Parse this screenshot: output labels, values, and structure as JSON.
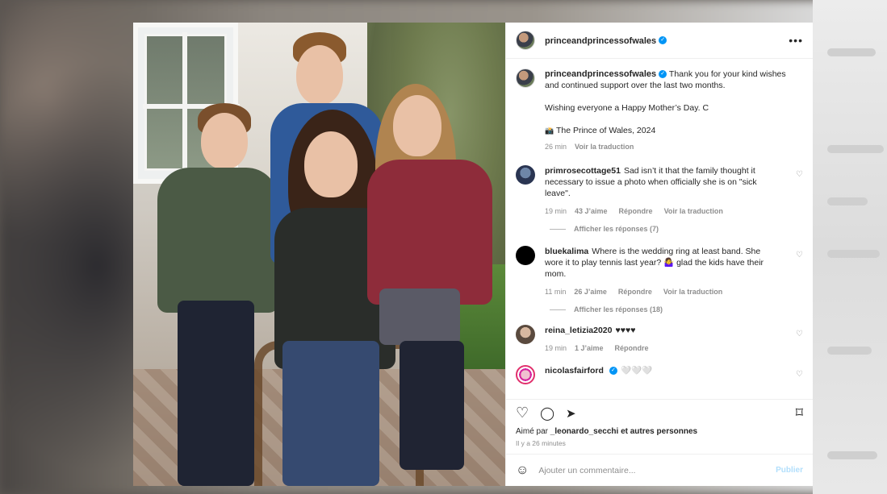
{
  "account": {
    "username": "princeandprincessofwales",
    "verified_mark": "✓"
  },
  "header": {
    "more_label": "•••"
  },
  "caption": {
    "username": "princeandprincessofwales",
    "line1": "Thank you for your kind wishes and continued support over the last two months.",
    "line2": "Wishing everyone a Happy Mother’s Day. C",
    "line3": "The Prince of Wales, 2024",
    "camera_icon": "📸",
    "time": "26 min",
    "translate": "Voir la traduction"
  },
  "comments": [
    {
      "username": "primrosecottage51",
      "text": "Sad isn’t it that the family thought it necessary to issue a photo when officially she is on \"sick leave\".",
      "time": "19 min",
      "likes": "43 J’aime",
      "reply": "Répondre",
      "translate": "Voir la traduction",
      "replies": "Afficher les réponses (7)"
    },
    {
      "username": "bluekalima",
      "text": "Where is the wedding ring at least band. She wore it to play tennis last year? 🤷‍♀️ glad the kids have their mom.",
      "time": "11 min",
      "likes": "26 J’aime",
      "reply": "Répondre",
      "translate": "Voir la traduction",
      "replies": "Afficher les réponses (18)"
    },
    {
      "username": "reina_letizia2020",
      "text": "♥♥♥♥",
      "time": "19 min",
      "likes": "1 J’aime",
      "reply": "Répondre"
    },
    {
      "username": "nicolasfairford",
      "text": "🤍🤍🤍"
    }
  ],
  "actions": {
    "heart_icon": "♡",
    "comment_icon": "◯",
    "share_icon": "➤",
    "save_icon": "⌑"
  },
  "likes": {
    "prefix": "Aimé par",
    "user": "_leonardo_secchi",
    "suffix": "et autres personnes",
    "ago": "Il y a 26 minutes"
  },
  "add_comment": {
    "emoji_icon": "☺",
    "placeholder": "Ajouter un commentaire...",
    "publish": "Publier"
  },
  "colors": {
    "verified": "#0095f6",
    "publish_disabled": "#b2dffc",
    "muted": "#8e8e8e"
  }
}
